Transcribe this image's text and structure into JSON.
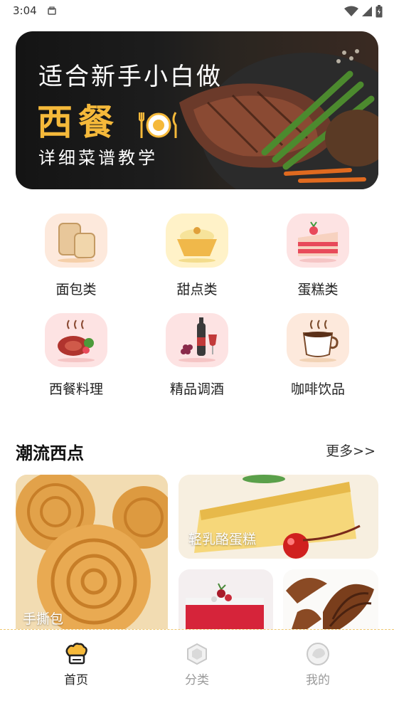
{
  "status_bar": {
    "time": "3:04"
  },
  "banner": {
    "line1": "适合新手小白做",
    "line2": "西餐",
    "line3": "详细菜谱教学"
  },
  "categories": [
    {
      "label": "面包类",
      "icon": "bread-icon",
      "bg": "#fde9dc"
    },
    {
      "label": "甜点类",
      "icon": "pudding-icon",
      "bg": "#fff2c8"
    },
    {
      "label": "蛋糕类",
      "icon": "cake-icon",
      "bg": "#fde3e3"
    },
    {
      "label": "西餐料理",
      "icon": "steak-icon",
      "bg": "#fde3e3"
    },
    {
      "label": "精品调酒",
      "icon": "wine-icon",
      "bg": "#fde3e3"
    },
    {
      "label": "咖啡饮品",
      "icon": "coffee-icon",
      "bg": "#fde9dc"
    }
  ],
  "section": {
    "title": "潮流西点",
    "more": "更多>>"
  },
  "cards": [
    {
      "label": "手撕包"
    },
    {
      "label": "轻乳酪蛋糕"
    },
    {
      "label": ""
    },
    {
      "label": ""
    }
  ],
  "tabbar": {
    "tabs": [
      {
        "label": "首页",
        "active": true
      },
      {
        "label": "分类",
        "active": false
      },
      {
        "label": "我的",
        "active": false
      }
    ]
  },
  "colors": {
    "accent": "#f5b93a",
    "tab_active": "#222222",
    "tab_inactive": "#9a9a9a"
  }
}
